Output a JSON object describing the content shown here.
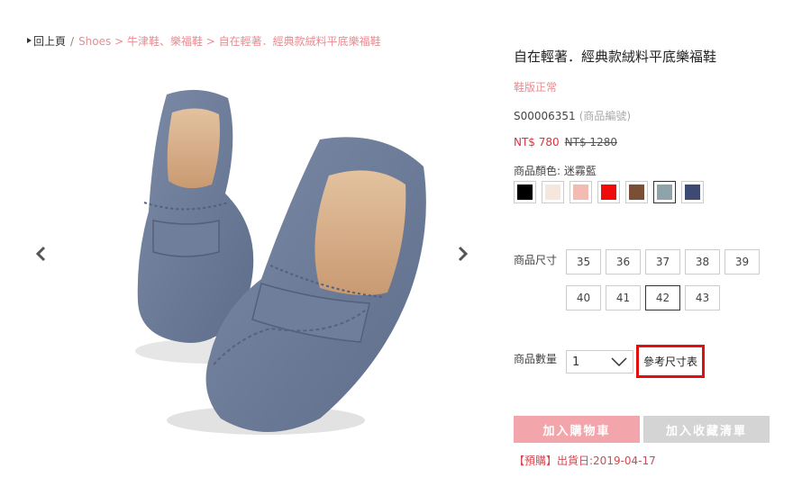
{
  "breadcrumb": {
    "back": "回上頁",
    "separator": "/",
    "path": "Shoes > 牛津鞋、樂福鞋 > 自在輕著．經典款絨料平底樂福鞋"
  },
  "gallery": {
    "prev_icon": "chevron-left-icon",
    "next_icon": "chevron-right-icon"
  },
  "product": {
    "title": "自在輕著．經典款絨料平底樂福鞋",
    "fit": "鞋版正常",
    "sku": "S00006351",
    "sku_label": "(商品編號)",
    "price_sale": "NT$ 780",
    "price_original": "NT$ 1280"
  },
  "color": {
    "label": "商品顏色: 迷霧藍",
    "swatches": [
      "#000000",
      "#f7e6dc",
      "#f2bcb2",
      "#ee0c0c",
      "#7a4f36",
      "#8fa3aa",
      "#3e4a74"
    ],
    "selected_index": 5
  },
  "size": {
    "label": "商品尺寸",
    "options": [
      "35",
      "36",
      "37",
      "38",
      "39",
      "40",
      "41",
      "42",
      "43"
    ],
    "selected": "42"
  },
  "quantity": {
    "label": "商品數量",
    "value": "1"
  },
  "actions": {
    "size_chart": "參考尺寸表",
    "add_to_cart": "加入購物車",
    "add_to_wishlist": "加入收藏清單"
  },
  "shipping": {
    "preorder": "【預購】出貨日:2019-04-17"
  },
  "colors": {
    "accent_pink": "#e98c92",
    "price_red": "#e0303a",
    "cart_button": "#f2a6ab",
    "wish_button": "#d4d4d4",
    "highlight_box": "#e01010"
  }
}
